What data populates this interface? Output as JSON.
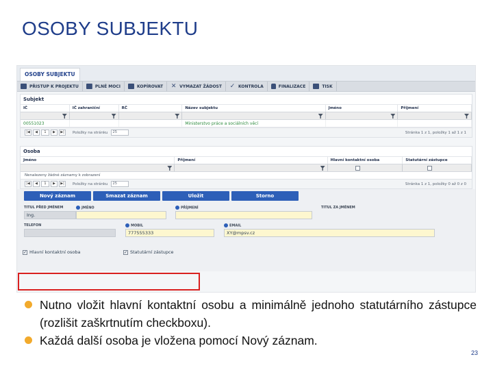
{
  "slide": {
    "title": "OSOBY SUBJEKTU",
    "page_number": "23"
  },
  "screenshot": {
    "tab": "OSOBY SUBJEKTU",
    "toolbar": [
      {
        "icon": "cart-icon",
        "label": "PŘISTUP K PROJEKTU"
      },
      {
        "icon": "mail-icon",
        "label": "PLNÉ MOCI"
      },
      {
        "icon": "copy-icon",
        "label": "KOPÍROVAT"
      },
      {
        "icon": "close-icon",
        "label": "VYMAZAT ŽÁDOST"
      },
      {
        "icon": "check-icon",
        "label": "KONTROLA"
      },
      {
        "icon": "lock-icon",
        "label": "FINALIZACE"
      },
      {
        "icon": "print-icon",
        "label": "TISK"
      }
    ],
    "subjekt": {
      "title": "Subjekt",
      "columns": [
        "IČ",
        "IČ zahraniční",
        "RČ",
        "Název subjektu",
        "Jméno",
        "Příjmení"
      ],
      "row": [
        "00551023",
        "",
        "",
        "Ministerstvo práce a sociálních věcí",
        "",
        ""
      ],
      "pager": {
        "first": "|◀",
        "prev": "◀",
        "page": "1",
        "next": "▶",
        "last": "▶|",
        "per_page_label": "Položky na stránku",
        "per_page": "25",
        "info": "Stránka 1 z 1, položky 1 až 1 z 1"
      }
    },
    "osoba": {
      "title": "Osoba",
      "columns": [
        "Jméno",
        "Příjmení",
        "Hlavní kontaktní osoba",
        "Statutární zástupce"
      ],
      "empty_note": "Nenalezeny žádné záznamy k zobrazení",
      "pager": {
        "first": "|◀",
        "prev": "◀",
        "page": "1",
        "next": "▶",
        "last": "▶|",
        "per_page_label": "Položky na stránku",
        "per_page": "25",
        "info": "Stránka 1 z 1, položky 0 až 0 z 0"
      }
    },
    "buttons": {
      "new": "Nový záznam",
      "delete": "Smazat záznam",
      "save": "Uložit",
      "cancel": "Storno"
    },
    "form": {
      "title_before_label": "TITUL PŘED JMÉNEM",
      "title_before_value": "Ing.",
      "first_name_label": "JMÉNO",
      "first_name_value": "",
      "last_name_label": "PŘÍJMENÍ",
      "last_name_value": "",
      "title_after_label": "TITUL ZA JMÉNEM",
      "title_after_value": "",
      "phone_label": "TELEFON",
      "phone_value": "",
      "mobile_label": "MOBIL",
      "mobile_value": "777555333",
      "email_label": "EMAIL",
      "email_value": "XY@mpsv.cz",
      "main_contact_label": "Hlavní kontaktní osoba",
      "main_contact_checked": true,
      "statutory_label": "Statutární zástupce",
      "statutory_checked": true
    }
  },
  "bullets": [
    "Nutno vložit hlavní kontaktní osobu a minimálně jednoho statutárního zástupce (rozlišit zaškrtnutím checkboxu).",
    "Každá další osoba je vložena pomocí Nový záznam."
  ],
  "colors": {
    "title": "#1f3d8a",
    "bullet": "#f2aa2c",
    "highlight_border": "#d9201f",
    "button": "#2d5fb8"
  }
}
